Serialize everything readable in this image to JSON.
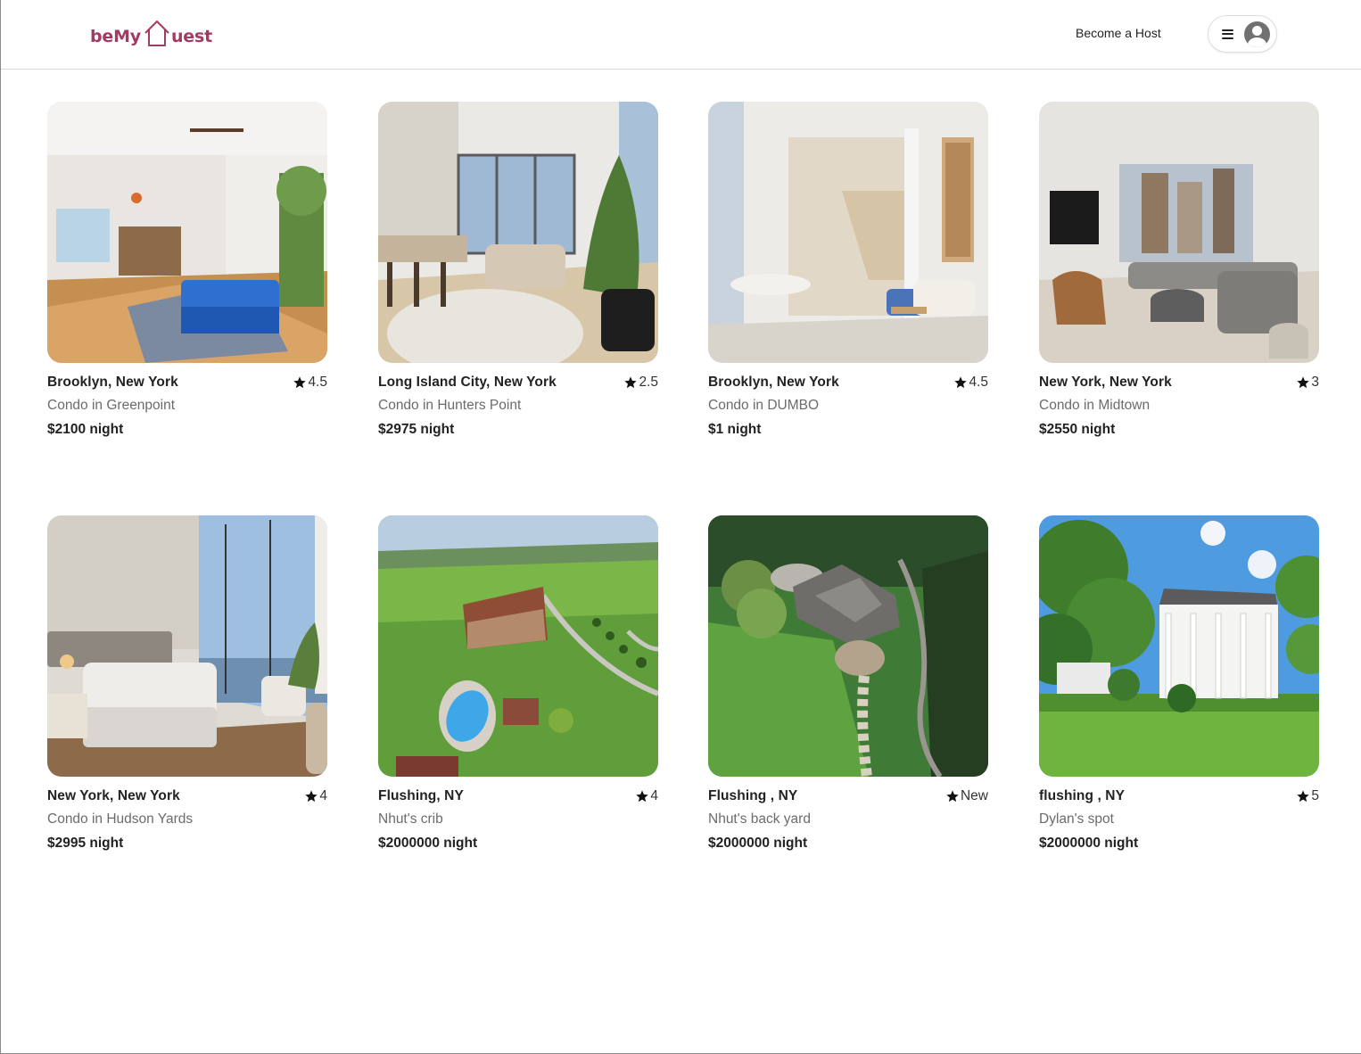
{
  "brand": {
    "part1": "beMy",
    "part2": "uest",
    "color": "#a33a63"
  },
  "header": {
    "host_link": "Become a Host"
  },
  "listings": [
    {
      "location": "Brooklyn, New York",
      "rating": "4.5",
      "title": "Condo in Greenpoint",
      "price": "$2100 night"
    },
    {
      "location": "Long Island City, New York",
      "rating": "2.5",
      "title": "Condo in Hunters Point",
      "price": "$2975 night"
    },
    {
      "location": "Brooklyn, New York",
      "rating": "4.5",
      "title": "Condo in DUMBO",
      "price": "$1 night"
    },
    {
      "location": "New York, New York",
      "rating": "3",
      "title": "Condo in Midtown",
      "price": "$2550 night"
    },
    {
      "location": "New York, New York",
      "rating": "4",
      "title": "Condo in Hudson Yards",
      "price": "$2995 night"
    },
    {
      "location": "Flushing, NY",
      "rating": "4",
      "title": "Nhut's crib",
      "price": "$2000000 night"
    },
    {
      "location": "Flushing , NY",
      "rating": "New",
      "title": "Nhut's back yard",
      "price": "$2000000 night"
    },
    {
      "location": "flushing , NY",
      "rating": "5",
      "title": "Dylan's spot",
      "price": "$2000000 night"
    }
  ]
}
